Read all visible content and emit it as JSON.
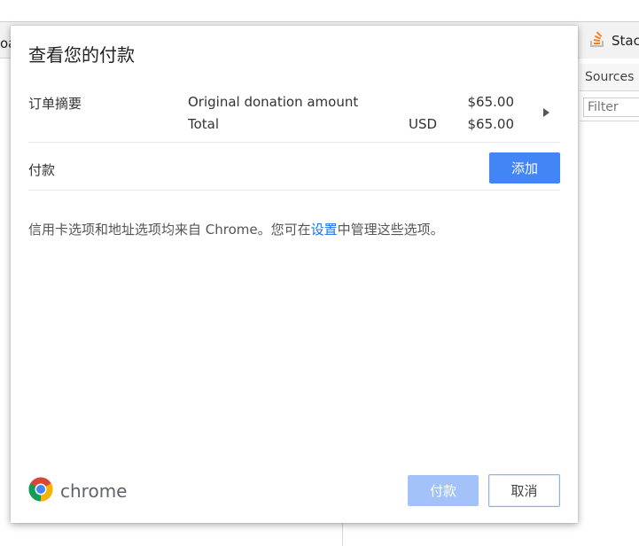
{
  "background": {
    "left_tab_text": "oa",
    "right_tab_title": "Stac",
    "right_tab_icon": "stack-overflow-icon",
    "devtools_tab": "Sources",
    "filter_placeholder": "Filter"
  },
  "dialog": {
    "title": "查看您的付款",
    "order_summary": {
      "label": "订单摘要",
      "items": [
        {
          "label": "Original donation amount",
          "currency": "",
          "amount": "$65.00"
        },
        {
          "label": "Total",
          "currency": "USD",
          "amount": "$65.00"
        }
      ],
      "expand_icon": "triangle-right-icon"
    },
    "payment": {
      "label": "付款",
      "add_button": "添加"
    },
    "info": {
      "before_link": "信用卡选项和地址选项均来自 Chrome。您可在",
      "link": "设置",
      "after_link": "中管理这些选项。"
    },
    "footer": {
      "logo_text": "chrome",
      "logo_icon": "chrome-logo-icon",
      "pay_button": "付款",
      "cancel_button": "取消"
    }
  },
  "colors": {
    "accent": "#4285f4",
    "accent_disabled": "#a2c2f9",
    "link": "#1a73e8"
  }
}
